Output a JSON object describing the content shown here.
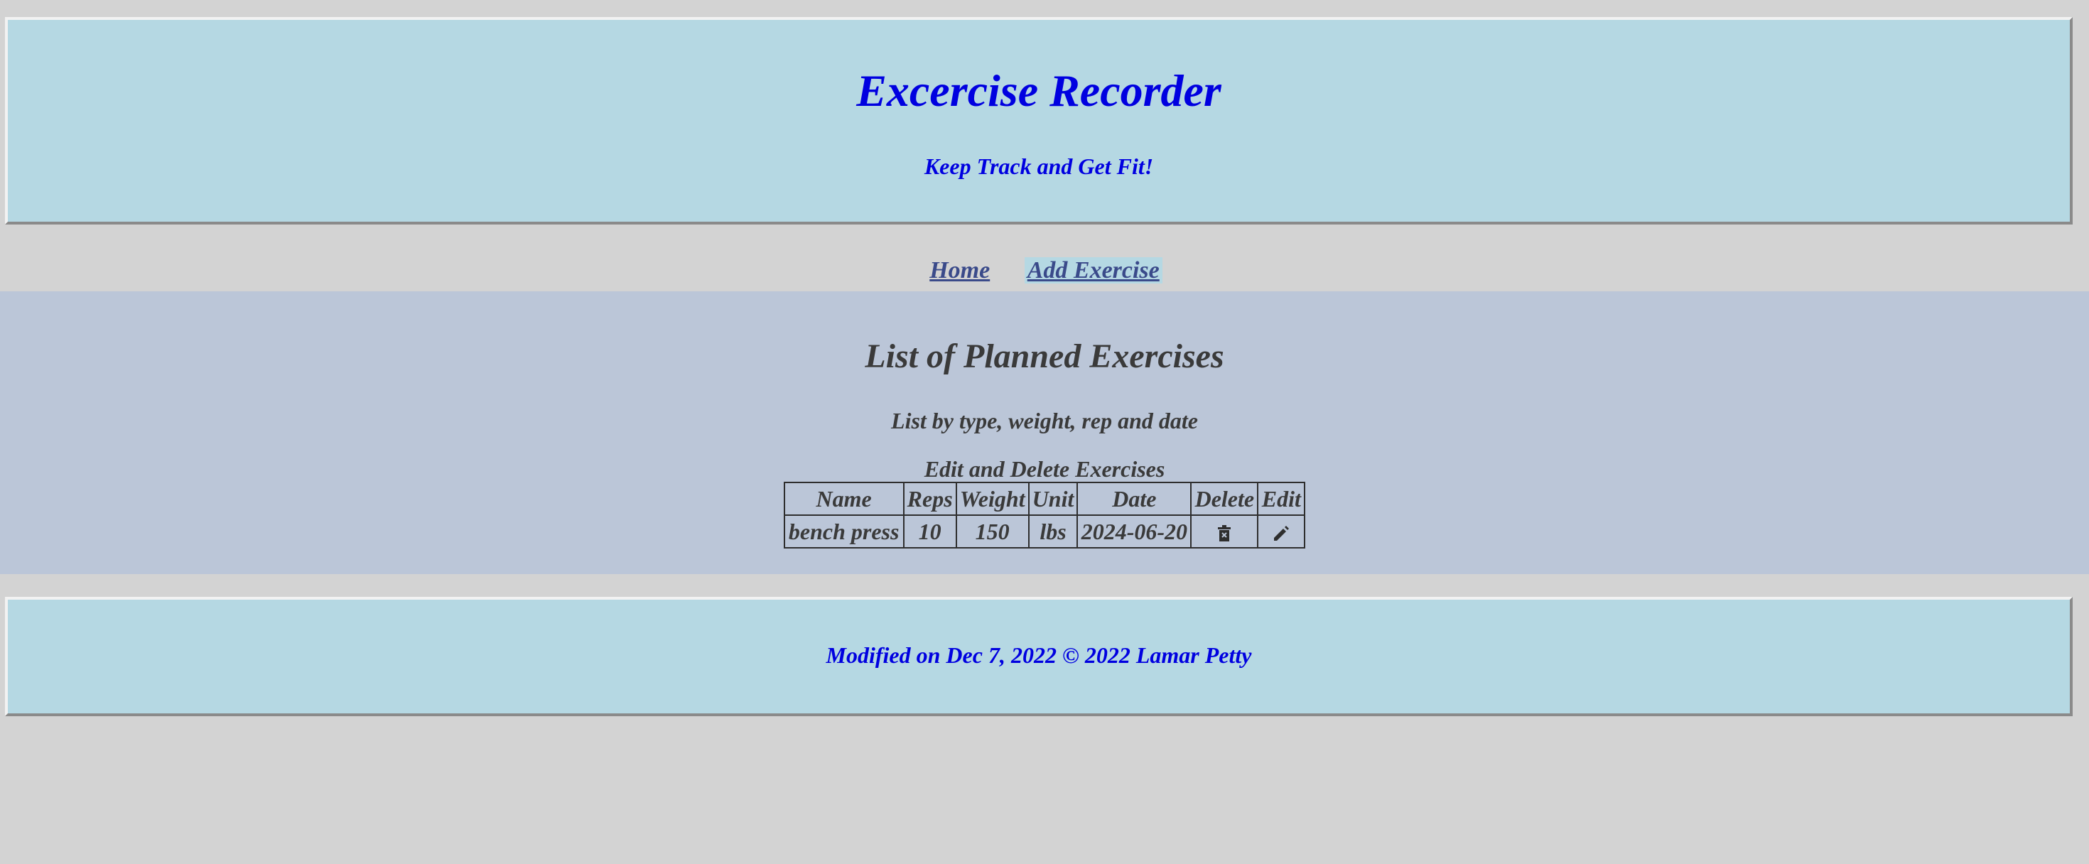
{
  "header": {
    "title": "Excercise Recorder",
    "tagline": "Keep Track and Get Fit!"
  },
  "nav": {
    "home": "Home",
    "add_exercise": "Add Exercise"
  },
  "main": {
    "title": "List of Planned Exercises",
    "subtitle": "List by type, weight, rep and date",
    "table": {
      "caption": "Edit and Delete Exercises",
      "headers": [
        "Name",
        "Reps",
        "Weight",
        "Unit",
        "Date",
        "Delete",
        "Edit"
      ],
      "rows": [
        {
          "name": "bench press",
          "reps": "10",
          "weight": "150",
          "unit": "lbs",
          "date": "2024-06-20",
          "delete_icon": "trash-icon",
          "edit_icon": "pencil-icon"
        }
      ]
    }
  },
  "footer": {
    "text": "Modified on Dec 7, 2022 © 2022 Lamar Petty"
  },
  "colors": {
    "page_background": "#d3d3d3",
    "banner_background": "#b5d8e3",
    "banner_text": "#0000e0",
    "content_background": "#bbc6d8",
    "content_text": "#3a3a3a",
    "nav_link": "#3a4a8a"
  }
}
